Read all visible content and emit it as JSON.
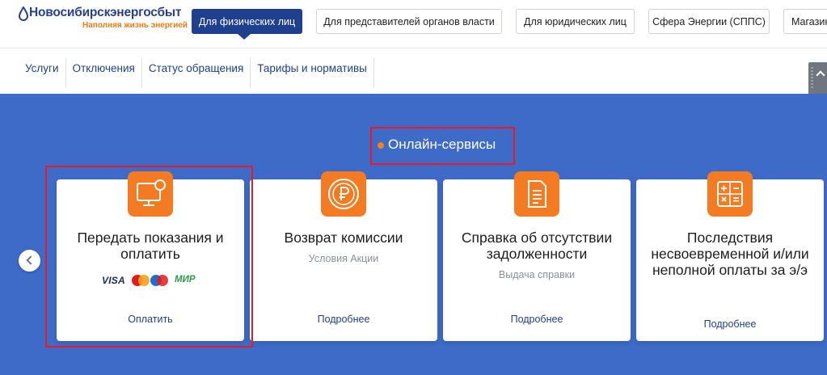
{
  "brand": {
    "name": "Новосибирскэнергосбыт",
    "slogan": "Наполняя жизнь энергией",
    "color_primary": "#27418f",
    "color_accent": "#f07a12"
  },
  "audience_tabs": [
    {
      "label": "Для физических лиц",
      "active": true
    },
    {
      "label": "Для представителей органов власти",
      "active": false
    },
    {
      "label": "Для юридических лиц",
      "active": false
    },
    {
      "label": "Сфера Энергии (СППС)",
      "active": false
    },
    {
      "label": "Магазин",
      "active": false
    }
  ],
  "subnav": [
    {
      "label": "Услуги"
    },
    {
      "label": "Отключения"
    },
    {
      "label": "Статус обращения"
    },
    {
      "label": "Тарифы и нормативы"
    }
  ],
  "services": {
    "title": "Онлайн-сервисы",
    "background": "#3e6bc8",
    "cards": [
      {
        "icon": "monitor-icon",
        "title": "Передать показания и оплатить",
        "payment_logos": [
          "VISA",
          "Mastercard",
          "Maestro",
          "МИР"
        ],
        "link": "Оплатить",
        "highlighted": true
      },
      {
        "icon": "ruble-coin-icon",
        "title": "Возврат комиссии",
        "subtitle": "Условия Акции",
        "link": "Подробнее"
      },
      {
        "icon": "document-icon",
        "title": "Справка об отсутствии задолженности",
        "subtitle": "Выдача справки",
        "link": "Подробнее"
      },
      {
        "icon": "calculator-icon",
        "title": "Последствия несвоевременной и/или неполной оплаты за э/э",
        "link": "Подробнее"
      }
    ]
  }
}
